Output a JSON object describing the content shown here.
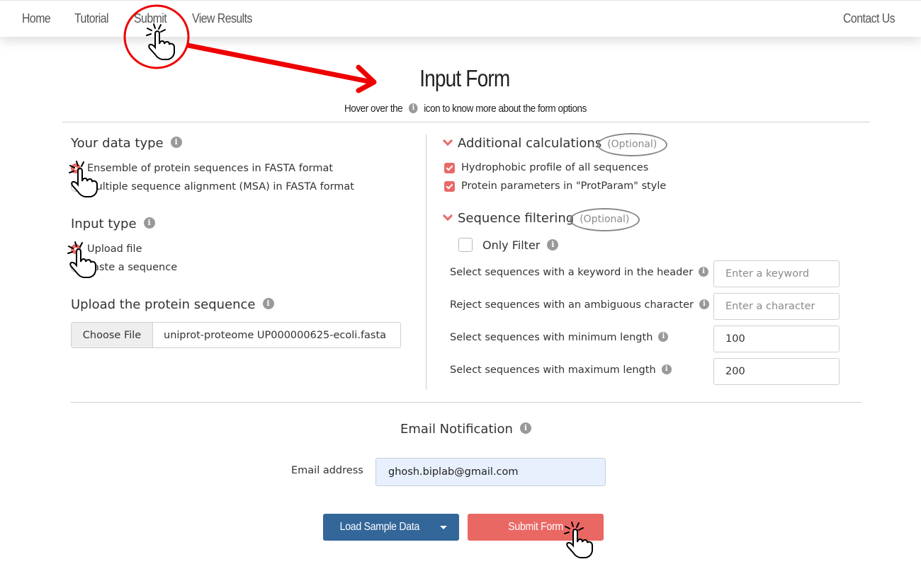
{
  "nav": {
    "items": [
      {
        "label": "Home"
      },
      {
        "label": "Tutorial"
      },
      {
        "label": "Submit"
      },
      {
        "label": "View Results"
      }
    ],
    "contact_label": "Contact Us"
  },
  "header": {
    "title": "Input Form",
    "hint_before": "Hover over the",
    "hint_after": "icon to know more about the form options",
    "info_glyph": "i"
  },
  "data_type": {
    "label": "Your data type",
    "options": [
      {
        "label": "Ensemble of protein sequences in FASTA format",
        "selected": true
      },
      {
        "label": "Multiple sequence alignment (MSA) in FASTA format",
        "selected": false
      }
    ]
  },
  "input_type": {
    "label": "Input type",
    "options": [
      {
        "label": "Upload file",
        "selected": true
      },
      {
        "label": "Paste a sequence",
        "selected": false
      }
    ]
  },
  "upload": {
    "label": "Upload the protein sequence",
    "button_label": "Choose File",
    "file_name": "uniprot-proteome UP000000625-ecoli.fasta"
  },
  "additional": {
    "title": "Additional calculations",
    "optional_label": "(Optional)",
    "options": [
      {
        "label": "Hydrophobic profile of all sequences",
        "checked": true
      },
      {
        "label": "Protein parameters in \"ProtParam\" style",
        "checked": true
      }
    ]
  },
  "filtering": {
    "title": "Sequence filtering",
    "optional_label": "(Optional)",
    "only_filter_label": "Only Filter",
    "only_filter_checked": false,
    "fields": [
      {
        "label": "Select sequences with a keyword in the header",
        "value": "",
        "placeholder": "Enter a keyword"
      },
      {
        "label": "Reject sequences with an ambiguous character",
        "value": "",
        "placeholder": "Enter a character"
      },
      {
        "label": "Select sequences with minimum length",
        "value": "100",
        "placeholder": ""
      },
      {
        "label": "Select sequences with maximum length",
        "value": "200",
        "placeholder": ""
      }
    ]
  },
  "email": {
    "title": "Email Notification",
    "label": "Email address",
    "value": "ghosh.biplab@gmail.com"
  },
  "buttons": {
    "load_sample": "Load Sample Data",
    "submit": "Submit Form"
  },
  "colors": {
    "accent": "#ea6864",
    "primary": "#336699",
    "annotation": "#ee0000"
  }
}
